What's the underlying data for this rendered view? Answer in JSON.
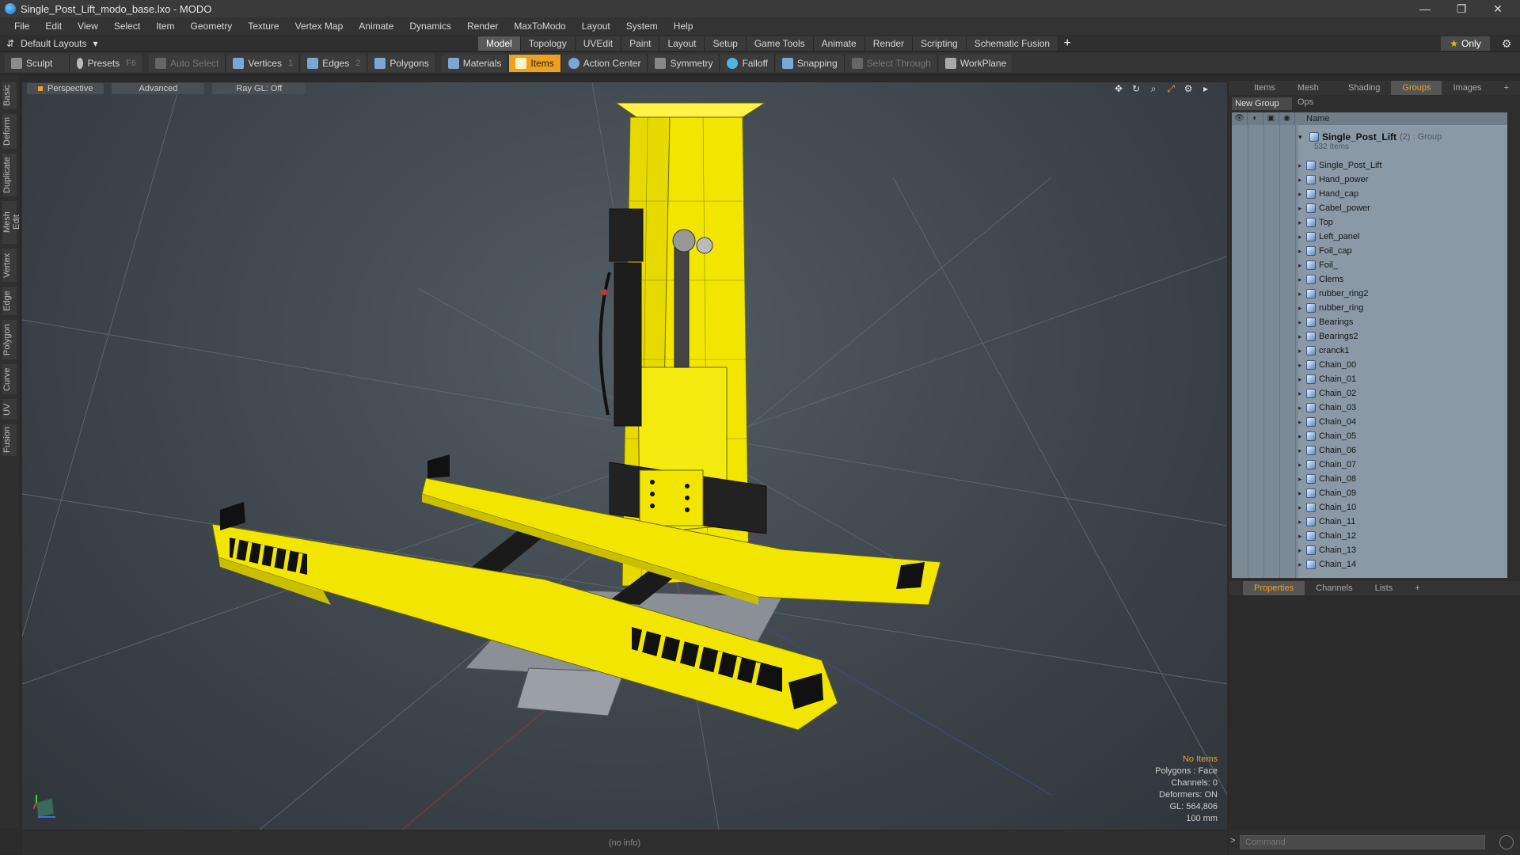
{
  "window": {
    "title": "Single_Post_Lift_modo_base.lxo - MODO",
    "controls": [
      "—",
      "❐",
      "✕"
    ]
  },
  "menu": [
    "File",
    "Edit",
    "View",
    "Select",
    "Item",
    "Geometry",
    "Texture",
    "Vertex Map",
    "Animate",
    "Dynamics",
    "Render",
    "MaxToModo",
    "Layout",
    "System",
    "Help"
  ],
  "layouts": {
    "label": "Default Layouts"
  },
  "mode_tabs": [
    {
      "label": "Model",
      "active": true
    },
    {
      "label": "Topology"
    },
    {
      "label": "UVEdit"
    },
    {
      "label": "Paint"
    },
    {
      "label": "Layout"
    },
    {
      "label": "Setup"
    },
    {
      "label": "Game Tools"
    },
    {
      "label": "Animate"
    },
    {
      "label": "Render"
    },
    {
      "label": "Scripting"
    },
    {
      "label": "Schematic Fusion"
    }
  ],
  "only_label": "Only",
  "toolbar": {
    "sculpt": "Sculpt",
    "presets": "Presets",
    "presets_key": "F6",
    "auto_select": "Auto Select",
    "vertices": "Vertices",
    "vertices_key": "1",
    "edges": "Edges",
    "edges_key": "2",
    "polygons": "Polygons",
    "materials": "Materials",
    "items": "Items",
    "action_center": "Action Center",
    "symmetry": "Symmetry",
    "falloff": "Falloff",
    "snapping": "Snapping",
    "select_through": "Select Through",
    "workplane": "WorkPlane"
  },
  "left_tabs": [
    "Basic",
    "Deform",
    "Duplicate",
    "Mesh Edit",
    "Vertex",
    "Edge",
    "Polygon",
    "Curve",
    "UV",
    "Fusion"
  ],
  "viewport": {
    "perspective": "Perspective",
    "advanced": "Advanced",
    "raygl": "Ray GL: Off",
    "info": {
      "no_items": "No Items",
      "polygons": "Polygons : Face",
      "channels": "Channels: 0",
      "deformers": "Deformers: ON",
      "gl": "GL: 564,806",
      "scale": "100 mm"
    }
  },
  "status": "(no info)",
  "right_panel": {
    "tabs": [
      {
        "label": "Items"
      },
      {
        "label": "Mesh Ops"
      },
      {
        "label": "Shading"
      },
      {
        "label": "Groups",
        "active": true
      },
      {
        "label": "Images"
      }
    ],
    "new_group": "New Group",
    "name_header": "Name",
    "group": {
      "name": "Single_Post_Lift",
      "count": "(2) : Group",
      "sub": "532 Items"
    },
    "items": [
      "Single_Post_Lift",
      "Hand_power",
      "Hand_cap",
      "Cabel_power",
      "Top",
      "Left_panel",
      "Foil_cap",
      "Foil_",
      "Clems",
      "rubber_ring2",
      "rubber_ring",
      "Bearings",
      "Bearings2",
      "cranck1",
      "Chain_00",
      "Chain_01",
      "Chain_02",
      "Chain_03",
      "Chain_04",
      "Chain_05",
      "Chain_06",
      "Chain_07",
      "Chain_08",
      "Chain_09",
      "Chain_10",
      "Chain_11",
      "Chain_12",
      "Chain_13",
      "Chain_14"
    ]
  },
  "bottom_panel": {
    "tabs": [
      {
        "label": "Properties",
        "active": true
      },
      {
        "label": "Channels"
      },
      {
        "label": "Lists"
      }
    ]
  },
  "command": {
    "placeholder": "Command"
  },
  "colors": {
    "accent": "#f0a020",
    "model_yellow": "#f2e600"
  }
}
